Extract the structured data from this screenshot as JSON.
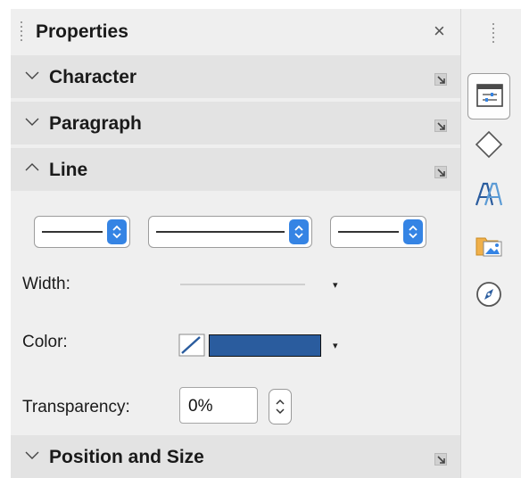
{
  "panel": {
    "title": "Properties",
    "close_glyph": "×"
  },
  "sections": {
    "character": {
      "label": "Character",
      "expanded": false
    },
    "paragraph": {
      "label": "Paragraph",
      "expanded": false
    },
    "line": {
      "label": "Line",
      "expanded": true
    },
    "position_size": {
      "label": "Position and Size",
      "expanded": false
    }
  },
  "line": {
    "width_label": "Width:",
    "color_label": "Color:",
    "transparency_label": "Transparency:",
    "transparency_value": "0%",
    "color_value": "#2a5c9e",
    "caret_glyph": "▾"
  },
  "tabs": [
    {
      "icon": "properties-icon",
      "active": true
    },
    {
      "icon": "shapes-icon",
      "active": false
    },
    {
      "icon": "styles-icon",
      "active": false
    },
    {
      "icon": "gallery-icon",
      "active": false
    },
    {
      "icon": "navigator-icon",
      "active": false
    }
  ],
  "colors": {
    "accent": "#3584e4",
    "section_header": "#e3e3e3",
    "panel_bg": "#efefef",
    "line_color": "#2a5c9e"
  }
}
